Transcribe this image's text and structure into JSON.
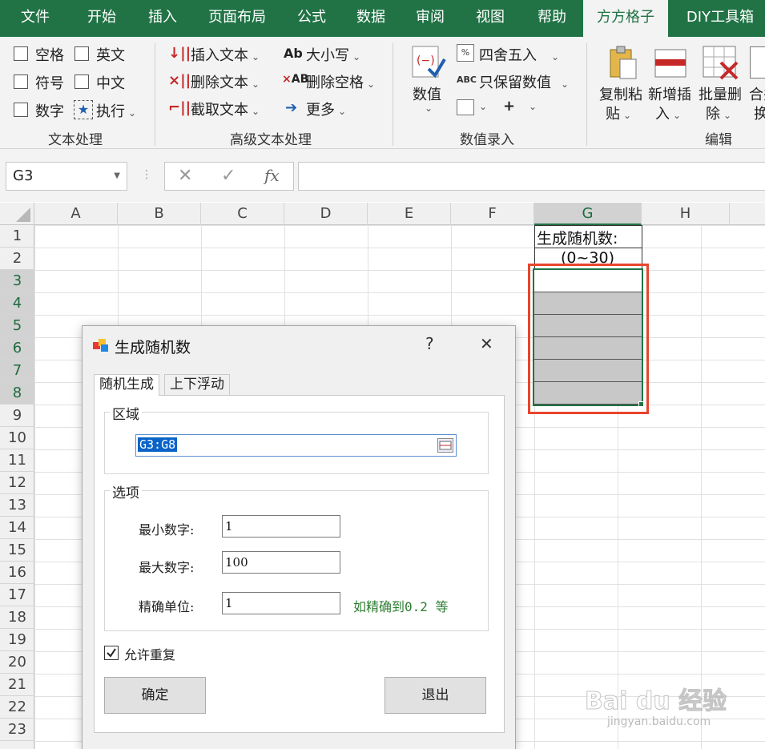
{
  "ribbon": {
    "tabs": [
      "文件",
      "开始",
      "插入",
      "页面布局",
      "公式",
      "数据",
      "审阅",
      "视图",
      "帮助",
      "方方格子",
      "DIY工具箱"
    ],
    "text_group": {
      "label": "文本处理",
      "items": [
        "空格",
        "英文",
        "符号",
        "中文",
        "数字",
        "执行"
      ]
    },
    "adv_group": {
      "label": "高级文本处理",
      "items": [
        "插入文本",
        "删除文本",
        "截取文本",
        "大小写",
        "删除空格",
        "更多"
      ]
    },
    "num_group": {
      "label": "数值录入",
      "big": "数值",
      "items": [
        "四舍五入",
        "只保留数值"
      ],
      "plus": "+"
    },
    "edit_group": {
      "label": "编辑",
      "items": [
        "复制粘",
        "贴",
        "新增插",
        "入",
        "批量删",
        "除",
        "合并",
        "换"
      ]
    }
  },
  "formula_bar": {
    "name_box": "G3",
    "fx": "fx",
    "cancel": "✕",
    "enter": "✓",
    "formula": ""
  },
  "grid": {
    "columns": [
      "A",
      "B",
      "C",
      "D",
      "E",
      "F",
      "G",
      "H"
    ],
    "rows": [
      "1",
      "2",
      "3",
      "4",
      "5",
      "6",
      "7",
      "8",
      "9",
      "10",
      "11",
      "12",
      "13",
      "14",
      "15",
      "16",
      "17",
      "18",
      "19",
      "20",
      "21",
      "22",
      "23"
    ],
    "g1": "生成随机数:",
    "g2": "(0~30)"
  },
  "dialog": {
    "title": "生成随机数",
    "help": "?",
    "close": "✕",
    "tabs": [
      "随机生成",
      "上下浮动"
    ],
    "area_legend": "区域",
    "area_value": "G3:G8",
    "options_legend": "选项",
    "min_label": "最小数字:",
    "min_value": "1",
    "max_label": "最大数字:",
    "max_value": "100",
    "prec_label": "精确单位:",
    "prec_value": "1",
    "prec_hint": "如精确到0.2 等",
    "allow_repeat": "允许重复",
    "ok": "确定",
    "exit": "退出"
  },
  "watermark": {
    "brand": "Bai du 经验",
    "url": "jingyan.baidu.com"
  },
  "colors": {
    "accent": "#217346",
    "highlight": "#e8452c",
    "range_fill": "#c8c8c8"
  }
}
